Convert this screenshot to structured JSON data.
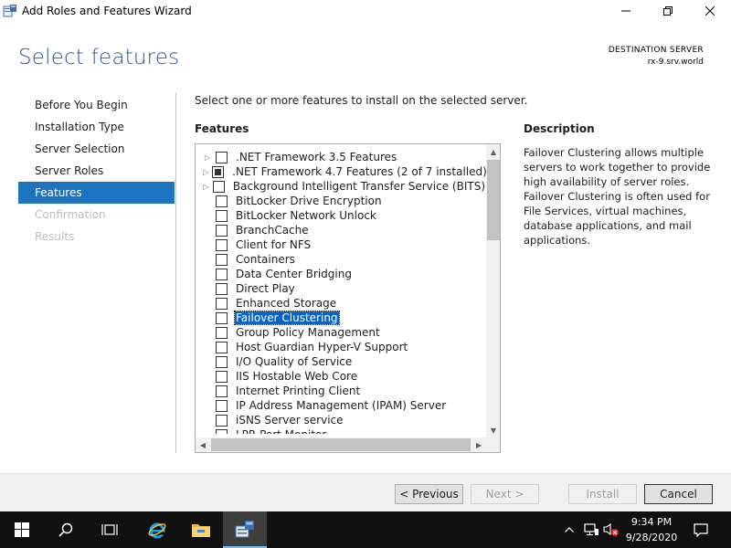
{
  "window": {
    "title": "Add Roles and Features Wizard",
    "accent_color": "#1e73be",
    "title_color": "#2b5797"
  },
  "header": {
    "page_title": "Select features",
    "destination_label": "DESTINATION SERVER",
    "destination_server": "rx-9.srv.world"
  },
  "nav": {
    "items": [
      {
        "label": "Before You Begin",
        "state": "normal"
      },
      {
        "label": "Installation Type",
        "state": "normal"
      },
      {
        "label": "Server Selection",
        "state": "normal"
      },
      {
        "label": "Server Roles",
        "state": "normal"
      },
      {
        "label": "Features",
        "state": "active"
      },
      {
        "label": "Confirmation",
        "state": "disabled"
      },
      {
        "label": "Results",
        "state": "disabled"
      }
    ]
  },
  "main": {
    "instruction": "Select one or more features to install on the selected server.",
    "features_heading": "Features",
    "features": [
      {
        "label": ".NET Framework 3.5 Features",
        "expandable": true,
        "state": "unchecked"
      },
      {
        "label": ".NET Framework 4.7 Features (2 of 7 installed)",
        "expandable": true,
        "state": "partial"
      },
      {
        "label": "Background Intelligent Transfer Service (BITS)",
        "expandable": true,
        "state": "unchecked"
      },
      {
        "label": "BitLocker Drive Encryption",
        "expandable": false,
        "state": "unchecked"
      },
      {
        "label": "BitLocker Network Unlock",
        "expandable": false,
        "state": "unchecked"
      },
      {
        "label": "BranchCache",
        "expandable": false,
        "state": "unchecked"
      },
      {
        "label": "Client for NFS",
        "expandable": false,
        "state": "unchecked"
      },
      {
        "label": "Containers",
        "expandable": false,
        "state": "unchecked"
      },
      {
        "label": "Data Center Bridging",
        "expandable": false,
        "state": "unchecked"
      },
      {
        "label": "Direct Play",
        "expandable": false,
        "state": "unchecked"
      },
      {
        "label": "Enhanced Storage",
        "expandable": false,
        "state": "unchecked"
      },
      {
        "label": "Failover Clustering",
        "expandable": false,
        "state": "unchecked",
        "selected": true
      },
      {
        "label": "Group Policy Management",
        "expandable": false,
        "state": "unchecked"
      },
      {
        "label": "Host Guardian Hyper-V Support",
        "expandable": false,
        "state": "unchecked"
      },
      {
        "label": "I/O Quality of Service",
        "expandable": false,
        "state": "unchecked"
      },
      {
        "label": "IIS Hostable Web Core",
        "expandable": false,
        "state": "unchecked"
      },
      {
        "label": "Internet Printing Client",
        "expandable": false,
        "state": "unchecked"
      },
      {
        "label": "IP Address Management (IPAM) Server",
        "expandable": false,
        "state": "unchecked"
      },
      {
        "label": "iSNS Server service",
        "expandable": false,
        "state": "unchecked"
      },
      {
        "label": "LPR Port Monitor",
        "expandable": false,
        "state": "unchecked"
      }
    ],
    "description_heading": "Description",
    "description_text": "Failover Clustering allows multiple servers to work together to provide high availability of server roles. Failover Clustering is often used for File Services, virtual machines, database applications, and mail applications."
  },
  "footer": {
    "previous_label": "< Previous",
    "next_label": "Next >",
    "install_label": "Install",
    "cancel_label": "Cancel"
  },
  "taskbar": {
    "time": "9:34 PM",
    "date": "9/28/2020",
    "icons": [
      "windows-start-icon",
      "search-icon",
      "task-view-icon",
      "internet-explorer-icon",
      "file-explorer-icon",
      "server-manager-icon"
    ],
    "tray_icons": [
      "chevron-up-icon",
      "network-icon",
      "volume-muted-icon",
      "notifications-icon"
    ]
  }
}
